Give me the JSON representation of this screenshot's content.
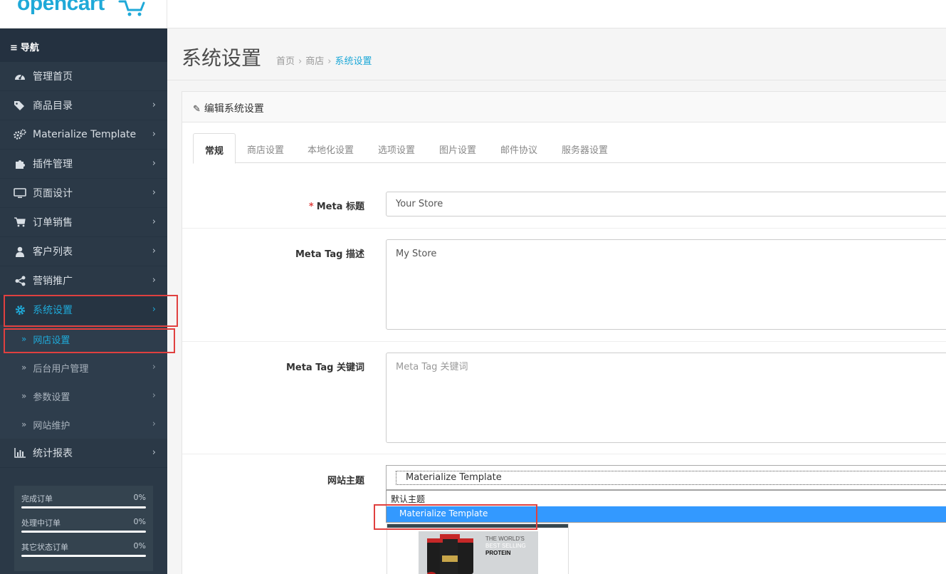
{
  "brand": {
    "logo_text": "opencart",
    "accent": "#1fa9d8",
    "sidebar_bg": "#2b3947",
    "highlight": "#e0403f"
  },
  "sidebar": {
    "title": "导航",
    "items": [
      {
        "label": "管理首页",
        "icon": "dashboard-icon"
      },
      {
        "label": "商品目录",
        "icon": "tags-icon"
      },
      {
        "label": "Materialize Template",
        "icon": "cogs-icon"
      },
      {
        "label": "插件管理",
        "icon": "puzzle-icon"
      },
      {
        "label": "页面设计",
        "icon": "monitor-icon"
      },
      {
        "label": "订单销售",
        "icon": "cart-icon"
      },
      {
        "label": "客户列表",
        "icon": "user-icon"
      },
      {
        "label": "营销推广",
        "icon": "share-icon"
      },
      {
        "label": "系统设置",
        "icon": "gear-icon"
      }
    ],
    "sub_items": [
      {
        "label": "网店设置"
      },
      {
        "label": "后台用户管理"
      },
      {
        "label": "参数设置"
      },
      {
        "label": "网站维护"
      }
    ],
    "reports": {
      "label": "统计报表",
      "icon": "bar-chart-icon"
    },
    "stats": [
      {
        "label": "完成订单",
        "value": "0%",
        "percent": 0
      },
      {
        "label": "处理中订单",
        "value": "0%",
        "percent": 0
      },
      {
        "label": "其它状态订单",
        "value": "0%",
        "percent": 0
      }
    ]
  },
  "header": {
    "title": "系统设置",
    "breadcrumb": [
      "首页",
      "商店",
      "系统设置"
    ]
  },
  "panel": {
    "title": "编辑系统设置",
    "tabs": [
      "常规",
      "商店设置",
      "本地化设置",
      "选项设置",
      "图片设置",
      "邮件协议",
      "服务器设置"
    ],
    "fields": {
      "meta_title": {
        "label": "Meta 标题",
        "required": "*",
        "value": "Your Store"
      },
      "meta_desc": {
        "label": "Meta Tag 描述",
        "value": "My Store"
      },
      "meta_keywords": {
        "label": "Meta Tag 关键词",
        "placeholder": "Meta Tag 关键词"
      },
      "theme": {
        "label": "网站主题",
        "value": "Materialize Template",
        "options": [
          "默认主题",
          "Materialize Template"
        ]
      }
    },
    "thumb_text": [
      "THE WORLD'S",
      "BEST SELLING",
      "PROTEIN"
    ]
  }
}
